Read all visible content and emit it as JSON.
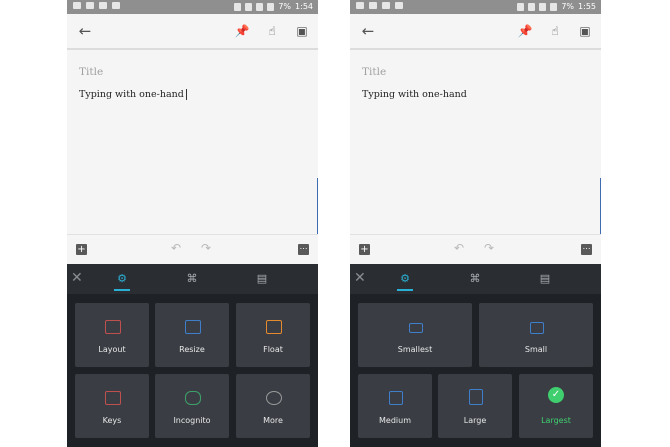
{
  "left": {
    "status": {
      "time": "1:54",
      "battery": "7%"
    },
    "note": {
      "title_placeholder": "Title",
      "body": "Typing with one-hand"
    },
    "tiles": [
      {
        "label": "Layout",
        "icon": "layout-icon",
        "color": "#c0504d"
      },
      {
        "label": "Resize",
        "icon": "resize-icon",
        "color": "#3f7fc9"
      },
      {
        "label": "Float",
        "icon": "float-icon",
        "color": "#e58a2e"
      },
      {
        "label": "Keys",
        "icon": "keys-icon",
        "color": "#c0504d"
      },
      {
        "label": "Incognito",
        "icon": "incognito-icon",
        "color": "#3fa06a"
      },
      {
        "label": "More",
        "icon": "more-icon",
        "color": "#9a9a9a"
      }
    ]
  },
  "right": {
    "status": {
      "time": "1:55",
      "battery": "7%"
    },
    "note": {
      "title_placeholder": "Title",
      "body": "Typing with one-hand"
    },
    "sizes": [
      {
        "label": "Smallest",
        "selected": false
      },
      {
        "label": "Small",
        "selected": false
      },
      {
        "label": "Medium",
        "selected": false
      },
      {
        "label": "Large",
        "selected": false
      },
      {
        "label": "Largest",
        "selected": true
      }
    ]
  },
  "colors": {
    "accent": "#2ab0d5",
    "selected": "#3fcf6f",
    "keyboard_bg": "#1e2125",
    "tile_bg": "#3a3e44"
  }
}
